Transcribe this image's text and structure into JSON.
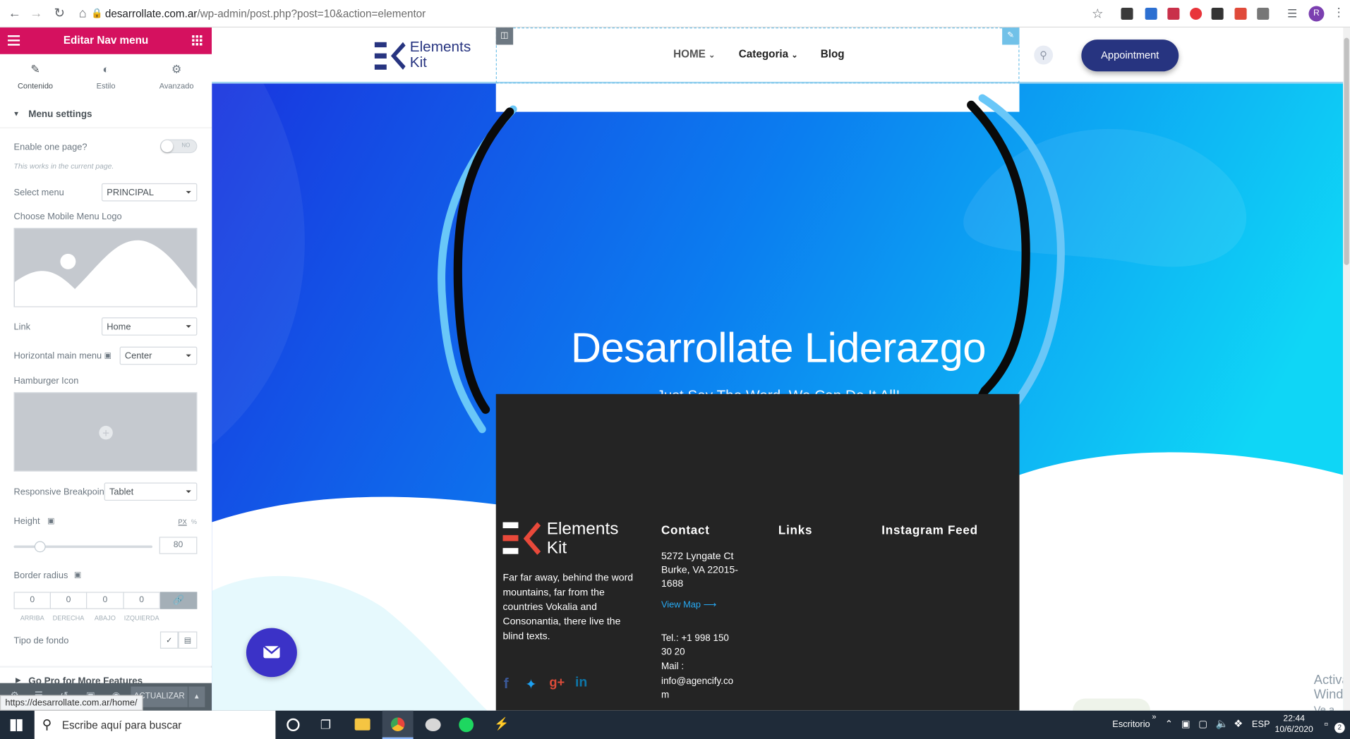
{
  "browser": {
    "url_host": "desarrollate.com.ar",
    "url_path": "/wp-admin/post.php?post=10&action=elementor",
    "profile_initial": "R",
    "status_url": "https://desarrollate.com.ar/home/"
  },
  "panel": {
    "title": "Editar Nav menu",
    "tabs": [
      {
        "label": "Contenido",
        "icon": "pencil-icon",
        "active": true
      },
      {
        "label": "Estilo",
        "icon": "half-circle-icon"
      },
      {
        "label": "Avanzado",
        "icon": "gear-icon"
      }
    ],
    "section_title": "Menu settings",
    "enable_one_page_label": "Enable one page?",
    "toggle_text": "NO",
    "one_page_hint": "This works in the current page.",
    "select_menu_label": "Select menu",
    "select_menu_value": "PRINCIPAL",
    "mobile_logo_label": "Choose Mobile Menu Logo",
    "link_label": "Link",
    "link_value": "Home",
    "horizontal_label": "Horizontal main menu",
    "horizontal_value": "Center",
    "hamburger_label": "Hamburger Icon",
    "breakpoint_label": "Responsive Breakpoint",
    "breakpoint_value": "Tablet",
    "height_label": "Height",
    "height_units": [
      "PX",
      "%"
    ],
    "height_value": "80",
    "border_radius_label": "Border radius",
    "border_values": [
      "0",
      "0",
      "0",
      "0"
    ],
    "border_captions": [
      "ARRIBA",
      "DERECHA",
      "ABAJO",
      "IZQUIERDA"
    ],
    "background_label": "Tipo de fondo",
    "go_pro_label": "Go Pro for More Features",
    "update_label": "ACTUALIZAR"
  },
  "site": {
    "logo_line1": "Elements",
    "logo_line2": "Kit",
    "menu": [
      {
        "label": "HOME",
        "dropdown": true,
        "color": "#555555"
      },
      {
        "label": "Categoria",
        "dropdown": true,
        "color": "#222222"
      },
      {
        "label": "Blog",
        "dropdown": false,
        "color": "#222222"
      }
    ],
    "appointment": "Appointment",
    "hero_title": "Desarrollate Liderazgo",
    "hero_subtitle": "Just Say The Word, We Can Do It All!",
    "footer": {
      "logo_line1": "Elements",
      "logo_line2": "Kit",
      "about": "Far far away, behind the word mountains, far from the countries Vokalia and Consonantia, there live the blind texts.",
      "contact_title": "Contact",
      "address": "5272 Lyngate Ct Burke, VA 22015-1688",
      "view_map": "View Map",
      "phone": "Tel.: +1 998 150 30 20",
      "mail_label": "Mail :",
      "mail": "info@agencify.co m",
      "links_title": "Links",
      "instagram_title": "Instagram Feed",
      "socials": [
        "facebook-icon",
        "twitter-icon",
        "google-plus-icon",
        "linkedin-icon"
      ]
    },
    "activate_title": "Activar Windows",
    "activate_sub": "Ve a Configuración para activar Windows."
  },
  "taskbar": {
    "search_placeholder": "Escribe aquí para buscar",
    "desktop_label": "Escritorio",
    "language": "ESP",
    "time": "22:44",
    "date": "10/6/2020",
    "notification_count": "2"
  },
  "colors": {
    "elementor_pink": "#d5115f",
    "appointment_navy": "#273480",
    "hero_blue_start": "#1a3fe0",
    "hero_blue_end": "#10cdf5",
    "footer_bg": "#242424",
    "link_blue": "#27a9f2"
  }
}
